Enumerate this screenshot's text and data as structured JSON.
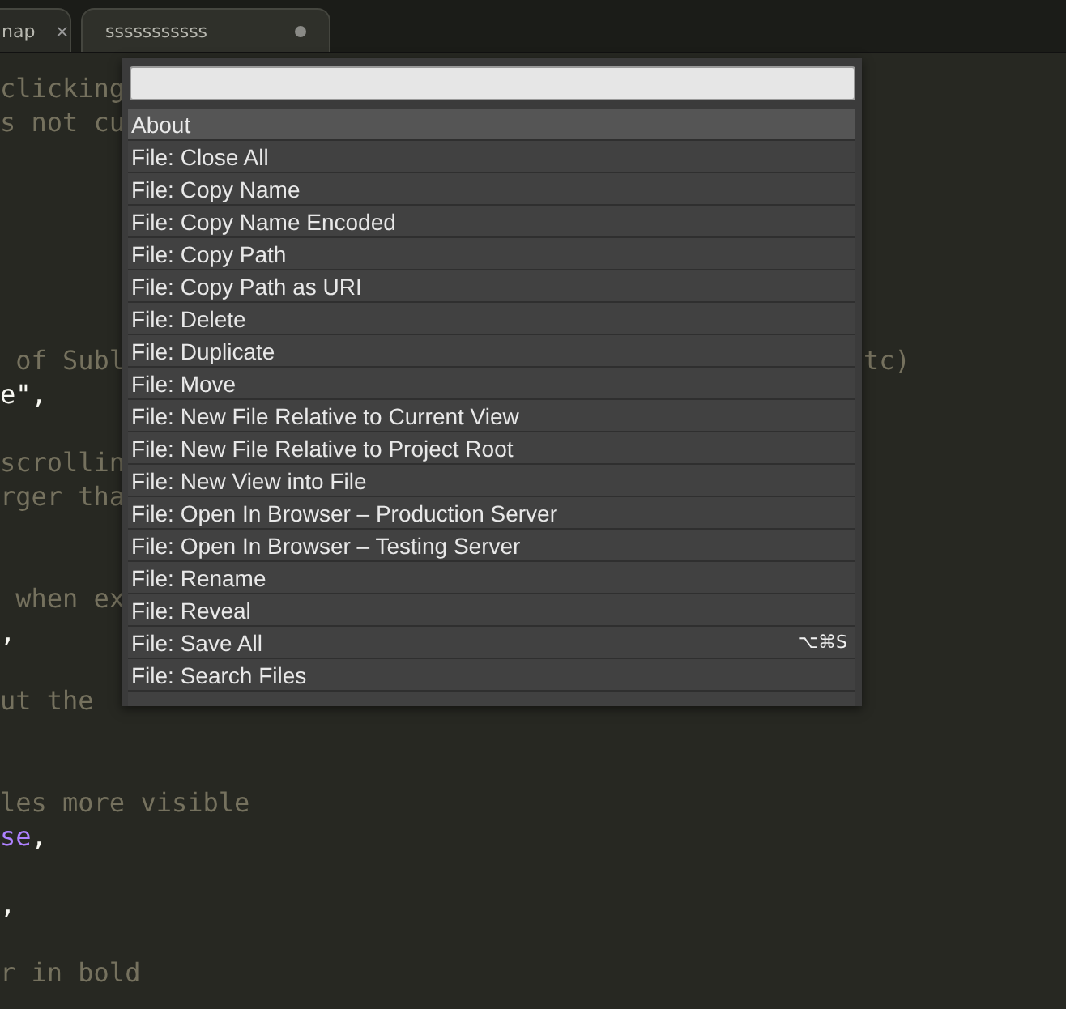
{
  "tabs": [
    {
      "label": "nap",
      "selected": false,
      "close": "×"
    },
    {
      "label": "sssssssssss",
      "selected": true,
      "modified": true
    }
  ],
  "editor": {
    "lines": [
      {
        "kind": "code",
        "segments": [
          {
            "text": "clicking",
            "kind": "comment"
          }
        ]
      },
      {
        "kind": "code",
        "segments": [
          {
            "text": "s not cu",
            "kind": "comment"
          }
        ]
      },
      {
        "kind": "blank"
      },
      {
        "kind": "blank"
      },
      {
        "kind": "blank"
      },
      {
        "kind": "blank"
      },
      {
        "kind": "blank"
      },
      {
        "kind": "blank"
      },
      {
        "kind": "code",
        "segments": [
          {
            "text": " of Subl",
            "kind": "comment"
          }
        ],
        "right": {
          "text": "tc)",
          "kind": "comment"
        }
      },
      {
        "kind": "code",
        "segments": [
          {
            "text": "e\",",
            "kind": "plain"
          }
        ]
      },
      {
        "kind": "blank"
      },
      {
        "kind": "code",
        "segments": [
          {
            "text": "scrollin",
            "kind": "comment"
          }
        ]
      },
      {
        "kind": "code",
        "segments": [
          {
            "text": "rger tha",
            "kind": "comment"
          }
        ]
      },
      {
        "kind": "blank"
      },
      {
        "kind": "blank"
      },
      {
        "kind": "code",
        "segments": [
          {
            "text": " when ex",
            "kind": "comment"
          }
        ]
      },
      {
        "kind": "code",
        "segments": [
          {
            "text": ",",
            "kind": "plain"
          }
        ]
      },
      {
        "kind": "blank"
      },
      {
        "kind": "code",
        "segments": [
          {
            "text": "ut the",
            "kind": "comment"
          }
        ]
      },
      {
        "kind": "blank"
      },
      {
        "kind": "blank"
      },
      {
        "kind": "code",
        "segments": [
          {
            "text": "les more visible",
            "kind": "comment"
          }
        ]
      },
      {
        "kind": "code",
        "segments": [
          {
            "text": "se",
            "kind": "constant"
          },
          {
            "text": ",",
            "kind": "plain"
          }
        ]
      },
      {
        "kind": "blank"
      },
      {
        "kind": "code",
        "segments": [
          {
            "text": ",",
            "kind": "plain"
          }
        ]
      },
      {
        "kind": "blank"
      },
      {
        "kind": "code",
        "segments": [
          {
            "text": "r in bold",
            "kind": "comment"
          }
        ]
      }
    ]
  },
  "command_palette": {
    "items": [
      {
        "label": "About",
        "selected": true
      },
      {
        "label": "File: Close All",
        "selected": false
      },
      {
        "label": "File: Copy Name",
        "selected": false
      },
      {
        "label": "File: Copy Name Encoded",
        "selected": false
      },
      {
        "label": "File: Copy Path",
        "selected": false
      },
      {
        "label": "File: Copy Path as URI",
        "selected": false
      },
      {
        "label": "File: Delete",
        "selected": false
      },
      {
        "label": "File: Duplicate",
        "selected": false
      },
      {
        "label": "File: Move",
        "selected": false
      },
      {
        "label": "File: New File Relative to Current View",
        "selected": false
      },
      {
        "label": "File: New File Relative to Project Root",
        "selected": false
      },
      {
        "label": "File: New View into File",
        "selected": false
      },
      {
        "label": "File: Open In Browser – Production Server",
        "selected": false
      },
      {
        "label": "File: Open In Browser – Testing Server",
        "selected": false
      },
      {
        "label": "File: Rename",
        "selected": false
      },
      {
        "label": "File: Reveal",
        "selected": false
      },
      {
        "label": "File: Save All",
        "selected": false,
        "shortcut": "⌥⌘S"
      },
      {
        "label": "File: Search Files",
        "selected": false
      }
    ]
  }
}
